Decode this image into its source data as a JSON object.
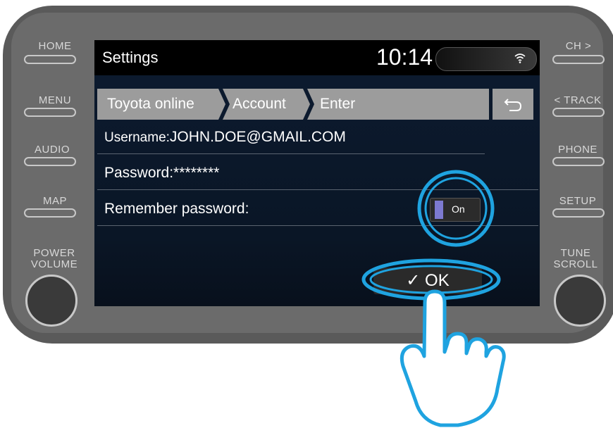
{
  "side_buttons": {
    "left": [
      "HOME",
      "MENU",
      "AUDIO",
      "MAP"
    ],
    "right": [
      "CH >",
      "< TRACK",
      "PHONE",
      "SETUP"
    ],
    "left_knob": [
      "POWER",
      "VOLUME"
    ],
    "right_knob": [
      "TUNE",
      "SCROLL"
    ]
  },
  "screen": {
    "title": "Settings",
    "clock": "10:14",
    "wifi_icon": "wifi-icon",
    "breadcrumb": [
      "Toyota online",
      "Account",
      "Enter"
    ],
    "back_icon": "back-arrow-icon",
    "username_label": "Username:",
    "username_value": "JOHN.DOE@GMAIL.COM",
    "password_label": "Password:",
    "password_value": "********",
    "remember_label": "Remember password:",
    "remember_toggle": "On",
    "ok_label": "✓ OK"
  },
  "colors": {
    "highlight": "#1fa3e0",
    "screen_bg": "#0c1a2e",
    "breadcrumb_bg": "#9c9c9c"
  }
}
